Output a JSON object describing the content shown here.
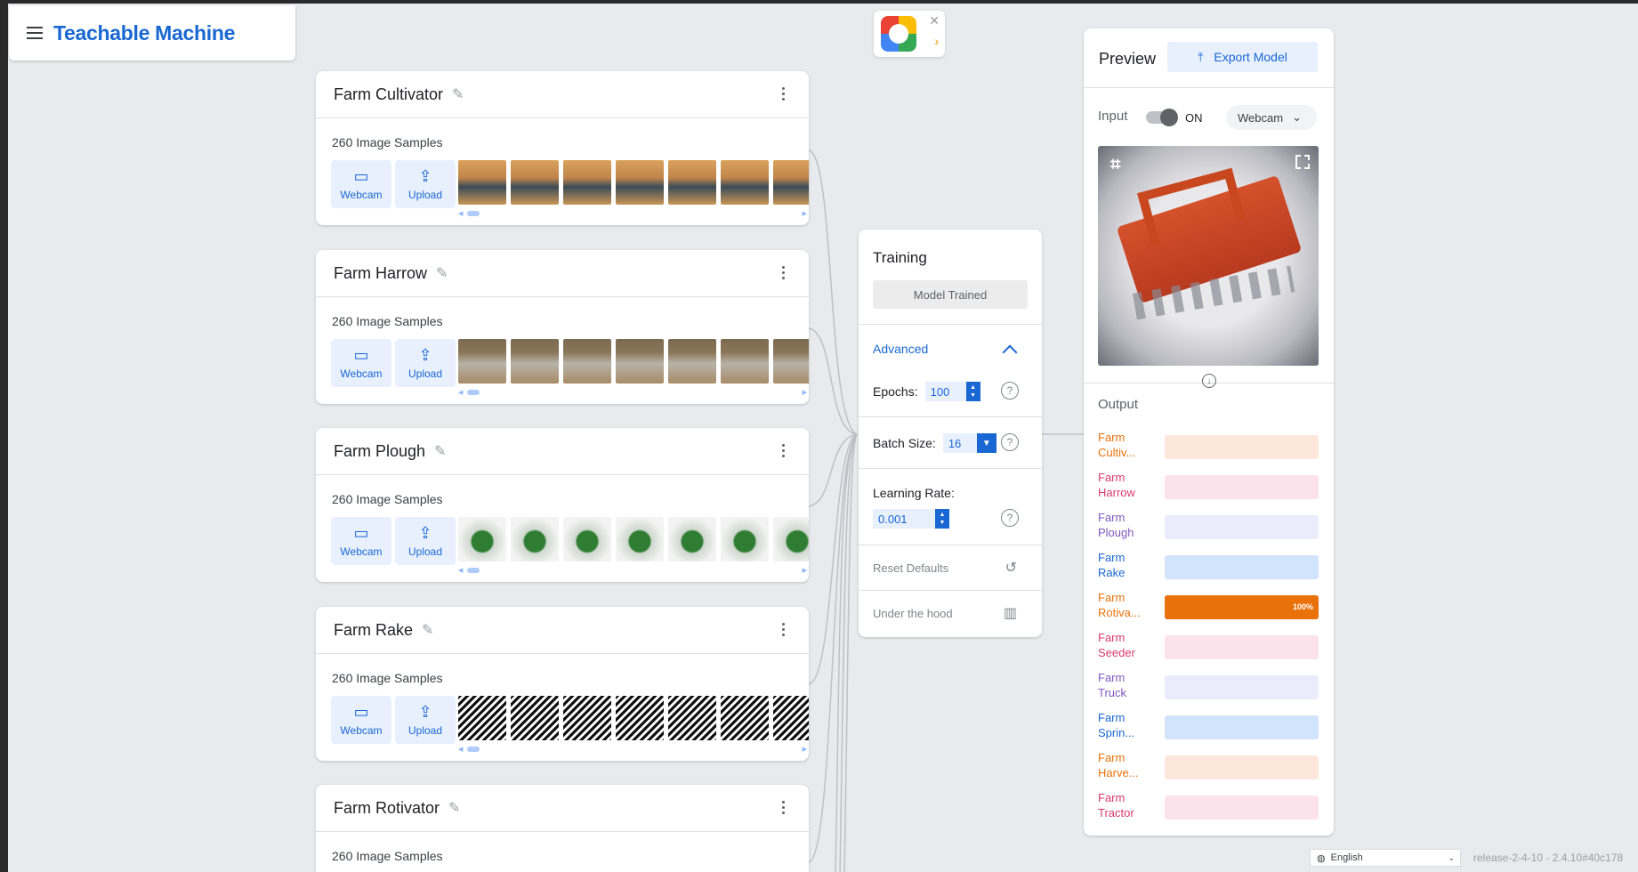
{
  "app": {
    "title": "Teachable Machine"
  },
  "classes": [
    {
      "name": "Farm Cultivator",
      "samples": "260 Image Samples",
      "thumb": "t-cult"
    },
    {
      "name": "Farm Harrow",
      "samples": "260 Image Samples",
      "thumb": "t-harrow"
    },
    {
      "name": "Farm Plough",
      "samples": "260 Image Samples",
      "thumb": "t-plough"
    },
    {
      "name": "Farm Rake",
      "samples": "260 Image Samples",
      "thumb": "t-rake"
    },
    {
      "name": "Farm Rotivator",
      "samples": "260 Image Samples",
      "thumb": "t-cult"
    }
  ],
  "card_buttons": {
    "webcam": "Webcam",
    "upload": "Upload"
  },
  "training": {
    "title": "Training",
    "status_button": "Model Trained",
    "advanced": "Advanced",
    "epochs_label": "Epochs:",
    "epochs_value": "100",
    "batch_label": "Batch Size:",
    "batch_value": "16",
    "lr_label": "Learning Rate:",
    "lr_value": "0.001",
    "reset": "Reset Defaults",
    "under_hood": "Under the hood"
  },
  "preview": {
    "title": "Preview",
    "export": "Export Model",
    "input_label": "Input",
    "toggle_state": "ON",
    "source": "Webcam",
    "output_label": "Output",
    "outputs": [
      {
        "name": "Farm Cultiv...",
        "color": "#e8710a",
        "bg": "#fde7dc",
        "value": 0
      },
      {
        "name": "Farm Harrow",
        "color": "#d93a6b",
        "bg": "#fce2ea",
        "value": 0
      },
      {
        "name": "Farm Plough",
        "color": "#7e57c2",
        "bg": "#ecebfb",
        "value": 0
      },
      {
        "name": "Farm Rake",
        "color": "#1967d2",
        "bg": "#d2e3fc",
        "value": 0
      },
      {
        "name": "Farm Rotiva...",
        "color": "#e8710a",
        "bg": "#fde7dc",
        "value": 100,
        "pct_label": "100%"
      },
      {
        "name": "Farm Seeder",
        "color": "#d93a6b",
        "bg": "#fce2ea",
        "value": 0
      },
      {
        "name": "Farm Truck",
        "color": "#7e57c2",
        "bg": "#ecebfb",
        "value": 0
      },
      {
        "name": "Farm Sprin...",
        "color": "#1967d2",
        "bg": "#d2e3fc",
        "value": 0
      },
      {
        "name": "Farm Harve...",
        "color": "#e8710a",
        "bg": "#fde7dc",
        "value": 0
      },
      {
        "name": "Farm Tractor",
        "color": "#d93a6b",
        "bg": "#fce2ea",
        "value": 0
      }
    ]
  },
  "footer": {
    "language": "English",
    "release": "release-2-4-10 - 2.4.10#40c178"
  }
}
